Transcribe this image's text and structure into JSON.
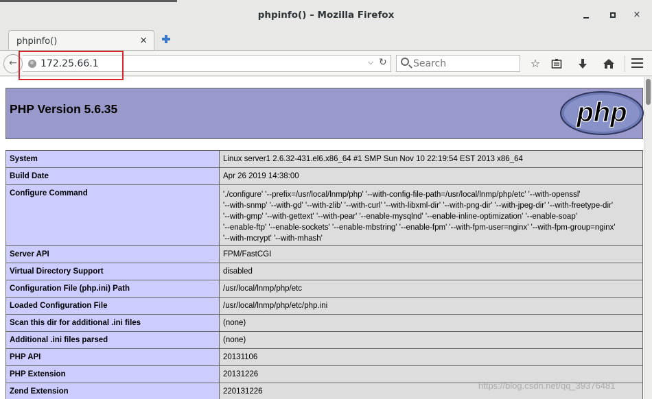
{
  "window": {
    "title": "phpinfo() – Mozilla Firefox",
    "controls": {
      "minimize": "minimize",
      "maximize": "maximize",
      "close": "×"
    }
  },
  "tabs": [
    {
      "label": "phpinfo()",
      "close": "×",
      "active": true
    }
  ],
  "navbar": {
    "url": "172.25.66.1",
    "search_placeholder": "Search",
    "dropdown_glyph": "⌵",
    "reload_glyph": "↻",
    "back_glyph": "←"
  },
  "page": {
    "heading": "PHP Version 5.6.35",
    "logo_text": "php",
    "rows": [
      {
        "key": "System",
        "value": "Linux server1 2.6.32-431.el6.x86_64 #1 SMP Sun Nov 10 22:19:54 EST 2013 x86_64"
      },
      {
        "key": "Build Date",
        "value": "Apr 26 2019 14:38:00"
      },
      {
        "key": "Configure Command",
        "value": ""
      },
      {
        "key": "Server API",
        "value": "FPM/FastCGI"
      },
      {
        "key": "Virtual Directory Support",
        "value": "disabled"
      },
      {
        "key": "Configuration File (php.ini) Path",
        "value": "/usr/local/lnmp/php/etc"
      },
      {
        "key": "Loaded Configuration File",
        "value": "/usr/local/lnmp/php/etc/php.ini"
      },
      {
        "key": "Scan this dir for additional .ini files",
        "value": "(none)"
      },
      {
        "key": "Additional .ini files parsed",
        "value": "(none)"
      },
      {
        "key": "PHP API",
        "value": "20131106"
      },
      {
        "key": "PHP Extension",
        "value": "20131226"
      },
      {
        "key": "Zend Extension",
        "value": "220131226"
      }
    ],
    "configure_lines": [
      "'./configure' '--prefix=/usr/local/lnmp/php' '--with-config-file-path=/usr/local/lnmp/php/etc' '--with-openssl'",
      "'--with-snmp' '--with-gd' '--with-zlib' '--with-curl' '--with-libxml-dir' '--with-png-dir' '--with-jpeg-dir' '--with-freetype-dir'",
      "'--with-gmp' '--with-gettext' '--with-pear' '--enable-mysqlnd' '--enable-inline-optimization' '--enable-soap'",
      "'--enable-ftp' '--enable-sockets' '--enable-mbstring' '--enable-fpm' '--with-fpm-user=nginx' '--with-fpm-group=nginx'",
      "'--with-mcrypt' '--with-mhash'"
    ]
  },
  "watermark": "https://blog.csdn.net/qq_39376481",
  "colors": {
    "php_header": "#9999cc",
    "key_cell": "#ccccff",
    "value_cell": "#dddddd",
    "highlight": "#d9242b"
  }
}
